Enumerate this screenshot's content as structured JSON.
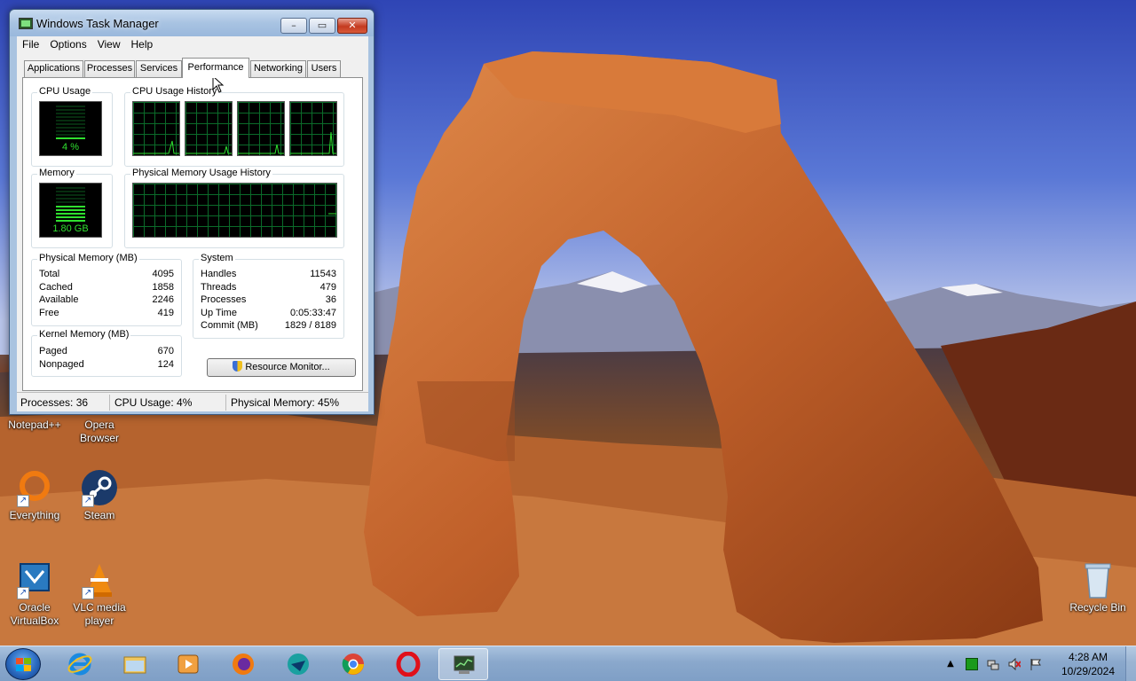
{
  "window": {
    "title": "Windows Task Manager",
    "menu": [
      "File",
      "Options",
      "View",
      "Help"
    ],
    "tabs": [
      "Applications",
      "Processes",
      "Services",
      "Performance",
      "Networking",
      "Users"
    ],
    "active_tab": "Performance",
    "cpu_usage": {
      "label": "CPU Usage",
      "value": "4 %",
      "percent": 4
    },
    "cpu_history": {
      "label": "CPU Usage History",
      "cores": 4
    },
    "memory": {
      "label": "Memory",
      "value": "1.80 GB"
    },
    "memory_history": {
      "label": "Physical Memory Usage History"
    },
    "physical_memory": {
      "label": "Physical Memory (MB)",
      "rows": [
        {
          "key": "Total",
          "value": "4095"
        },
        {
          "key": "Cached",
          "value": "1858"
        },
        {
          "key": "Available",
          "value": "2246"
        },
        {
          "key": "Free",
          "value": "419"
        }
      ]
    },
    "kernel_memory": {
      "label": "Kernel Memory (MB)",
      "rows": [
        {
          "key": "Paged",
          "value": "670"
        },
        {
          "key": "Nonpaged",
          "value": "124"
        }
      ]
    },
    "system": {
      "label": "System",
      "rows": [
        {
          "key": "Handles",
          "value": "11543"
        },
        {
          "key": "Threads",
          "value": "479"
        },
        {
          "key": "Processes",
          "value": "36"
        },
        {
          "key": "Up Time",
          "value": "0:05:33:47"
        },
        {
          "key": "Commit (MB)",
          "value": "1829 / 8189"
        }
      ]
    },
    "resource_monitor_button": "Resource Monitor...",
    "status": {
      "processes": "Processes: 36",
      "cpu": "CPU Usage: 4%",
      "memory": "Physical Memory: 45%"
    }
  },
  "desktop_icons": [
    {
      "label": "Notepad++",
      "icon": "notepadpp-icon"
    },
    {
      "label": "Opera Browser",
      "icon": "opera-icon"
    },
    {
      "label": "Everything",
      "icon": "everything-icon"
    },
    {
      "label": "Steam",
      "icon": "steam-icon"
    },
    {
      "label": "Oracle VirtualBox",
      "icon": "virtualbox-icon"
    },
    {
      "label": "VLC media player",
      "icon": "vlc-icon"
    },
    {
      "label": "Recycle Bin",
      "icon": "recycle-bin-icon"
    }
  ],
  "taskbar": {
    "pinned": [
      "internet-explorer-icon",
      "file-explorer-icon",
      "media-player-icon",
      "firefox-icon",
      "app-icon",
      "chrome-icon",
      "opera-icon",
      "task-manager-icon"
    ],
    "clock_time": "4:28 AM",
    "clock_date": "10/29/2024"
  },
  "colors": {
    "graph_green": "#2fe02f",
    "grid": "#0b6b2a",
    "title_bar": "#a8c3e2"
  }
}
